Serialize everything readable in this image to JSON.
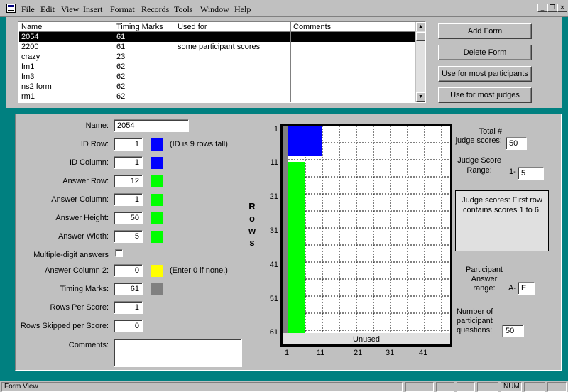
{
  "menubar": {
    "items": [
      "File",
      "Edit",
      "View",
      "Insert",
      "Format",
      "Records",
      "Tools",
      "Window",
      "Help"
    ],
    "controls": [
      "_",
      "❐",
      "×"
    ]
  },
  "form_list": {
    "headers": [
      "Name",
      "Timing Marks",
      "Used for",
      "Comments"
    ],
    "rows": [
      {
        "name": "2054",
        "timing": "61",
        "used_for": "",
        "comments": ""
      },
      {
        "name": "2200",
        "timing": "61",
        "used_for": "some participant scores",
        "comments": ""
      },
      {
        "name": "crazy",
        "timing": "23",
        "used_for": "",
        "comments": ""
      },
      {
        "name": "fm1",
        "timing": "62",
        "used_for": "",
        "comments": ""
      },
      {
        "name": "fm3",
        "timing": "62",
        "used_for": "",
        "comments": ""
      },
      {
        "name": "ns2 form",
        "timing": "62",
        "used_for": "",
        "comments": ""
      },
      {
        "name": "rm1",
        "timing": "62",
        "used_for": "",
        "comments": ""
      }
    ],
    "selected_index": 0
  },
  "buttons": {
    "add_form": "Add Form",
    "delete_form": "Delete Form",
    "use_participants": "Use for most participants",
    "use_judges": "Use for most judges"
  },
  "fields": {
    "name_label": "Name:",
    "name_value": "2054",
    "id_row_label": "ID Row:",
    "id_row_value": "1",
    "id_note": "(ID is  9  rows tall)",
    "id_column_label": "ID Column:",
    "id_column_value": "1",
    "answer_row_label": "Answer Row:",
    "answer_row_value": "12",
    "answer_column_label": "Answer Column:",
    "answer_column_value": "1",
    "answer_height_label": "Answer Height:",
    "answer_height_value": "50",
    "answer_width_label": "Answer Width:",
    "answer_width_value": "5",
    "multi_digit_label": "Multiple-digit answers",
    "answer_column2_label": "Answer Column 2:",
    "answer_column2_value": "0",
    "answer_column2_note": "(Enter 0 if none.)",
    "timing_marks_label": "Timing Marks:",
    "timing_marks_value": "61",
    "rows_per_score_label": "Rows Per Score:",
    "rows_per_score_value": "1",
    "rows_skipped_label": "Rows Skipped per Score:",
    "rows_skipped_value": "0",
    "comments_label": "Comments:",
    "comments_value": ""
  },
  "colors": {
    "id": "#0000ff",
    "answer": "#00ff00",
    "answer_column2": "#ffff00",
    "timing": "#808080"
  },
  "grid": {
    "rows_axis_label": "R o w s",
    "row_ticks": [
      "1",
      "11",
      "21",
      "31",
      "41",
      "51",
      "61"
    ],
    "col_ticks": [
      "1",
      "11",
      "21",
      "31",
      "41"
    ],
    "unused_label": "Unused"
  },
  "right_panel": {
    "total_label": "Total #\njudge scores:",
    "total_value": "50",
    "range_label": "Judge Score\nRange:",
    "range_prefix": "1-",
    "range_value": "5",
    "info_text": "Judge scores: First row contains scores 1 to 6.",
    "participant_label": "Participant\nAnswer\nrange:",
    "participant_prefix": "A-",
    "participant_value": "E",
    "questions_label": "Number of\nparticipant\nquestions:",
    "questions_value": "50"
  },
  "statusbar": {
    "text": "Form View",
    "num": "NUM"
  }
}
